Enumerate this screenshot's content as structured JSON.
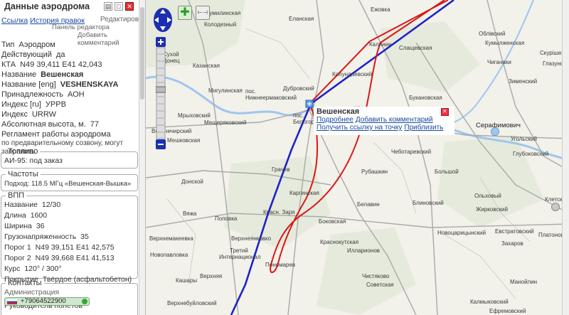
{
  "panel": {
    "title": "Данные аэродрома",
    "links": {
      "link": "Ссылка",
      "history": "История правок"
    },
    "edit": "Редактировать",
    "editor_panel": "Панель редактора",
    "add_comment": "Добавить комментарий",
    "rows": [
      {
        "label": "Тип",
        "value": "Аэродром"
      },
      {
        "label": "Действующий",
        "value": "да"
      },
      {
        "label": "КТА",
        "value": "N49 39,411 E41 42,043"
      },
      {
        "label": "Название",
        "value": "Вешенская"
      },
      {
        "label": "Название [eng]",
        "value": "VESHENSKAYA"
      },
      {
        "label": "Принадлежность",
        "value": "АОН"
      },
      {
        "label": "Индекс [ru]",
        "value": "УРРВ"
      },
      {
        "label": "Индекс",
        "value": "URRW"
      },
      {
        "label": "Абсолютная высота, м.",
        "value": "77"
      }
    ],
    "reglament_label": "Регламент работы аэродрома",
    "reglament_text": "по предварительному созвону, могут заправить",
    "fuel": {
      "legend": "Топливо",
      "text": "АИ-95: под заказ"
    },
    "freq": {
      "legend": "Частоты",
      "text": "Подход: 118.5 МГц «Вешенская-Вышка»"
    },
    "runway": {
      "legend": "ВПП",
      "rows": [
        {
          "label": "Название",
          "value": "12/30"
        },
        {
          "label": "Длина",
          "value": "1600"
        },
        {
          "label": "Ширина",
          "value": "36"
        },
        {
          "label": "Грузонапряженность",
          "value": "35"
        },
        {
          "label": "Порог 1",
          "value": "N49 39,151 E41 42,575"
        },
        {
          "label": "Порог 2",
          "value": "N49 39,668 E41 41,513"
        },
        {
          "label": "Курс",
          "value": "120° / 300°"
        },
        {
          "label": "Покрытие",
          "value": "Твёрдое (асфальтобетон)"
        }
      ]
    },
    "contacts": {
      "legend": "Контакты",
      "admin": "Администрация",
      "head": "Руководитель полётов",
      "phone": "+79064522900"
    }
  },
  "map": {
    "popup": {
      "title": "Вешенская",
      "link_more": "Подробнее",
      "link_comment": "Добавить комментарий",
      "link_point": "Получить ссылку на точку",
      "link_zoom": "Приблизить"
    },
    "places": [
      {
        "text": "Шумилинская"
      },
      {
        "text": "Еланская"
      },
      {
        "text": "Ежовка"
      },
      {
        "text": "Колодезный"
      },
      {
        "text": "Калинин"
      },
      {
        "text": "Слащевская"
      },
      {
        "text": "Облівский"
      },
      {
        "text": "Кумылженская"
      },
      {
        "text": "Скурішенская"
      },
      {
        "text": "Глазуновская"
      },
      {
        "text": "Чиганаки"
      },
      {
        "text": "Зименский"
      },
      {
        "text": "Сухой Донец"
      },
      {
        "text": "Казанская"
      },
      {
        "text": "Колундаевский"
      },
      {
        "text": "Букановская"
      },
      {
        "text": "пос. Нижнеермаковский"
      },
      {
        "text": "Дубровский"
      },
      {
        "text": "Мигулинская"
      },
      {
        "text": "Мрыховский"
      },
      {
        "text": "Мещеряковский"
      },
      {
        "text": "пос. Белогорск"
      },
      {
        "text": "Серафимович"
      },
      {
        "text": "Угольский"
      },
      {
        "text": "Верхнечирский"
      },
      {
        "text": "Мешковская"
      },
      {
        "text": "Чеботаревский"
      },
      {
        "text": "Глубоковский"
      },
      {
        "text": "Грачев"
      },
      {
        "text": "Рубашкин"
      },
      {
        "text": "Большой"
      },
      {
        "text": "Донской"
      },
      {
        "text": "Каргинская"
      },
      {
        "text": "Белавин"
      },
      {
        "text": "Блиновский"
      },
      {
        "text": "Ольховый"
      },
      {
        "text": "Жирковский"
      },
      {
        "text": "Клетский"
      },
      {
        "text": "Вяжа"
      },
      {
        "text": "Красн. Заря"
      },
      {
        "text": "Поповка"
      },
      {
        "text": "Боковская"
      },
      {
        "text": "Верхнемакеевка"
      },
      {
        "text": "Верхнеянковко"
      },
      {
        "text": "Краснокутская"
      },
      {
        "text": "Новоцарицынский"
      },
      {
        "text": "Евстратовский"
      },
      {
        "text": "Платонов"
      },
      {
        "text": "Новопавловка"
      },
      {
        "text": "Третий Интернационал"
      },
      {
        "text": "Илларионов"
      },
      {
        "text": "Захаров"
      },
      {
        "text": "Пономарев"
      },
      {
        "text": "Чистяково"
      },
      {
        "text": "Манойлин"
      },
      {
        "text": "Кашары"
      },
      {
        "text": "Верхняя"
      },
      {
        "text": "Советская"
      },
      {
        "text": "Калмыковский"
      },
      {
        "text": "Верхнебуйловский"
      },
      {
        "text": "Ефремовский"
      }
    ]
  },
  "colors": {
    "route_blue": "#1c22c8",
    "route_red": "#d81818",
    "road": "#a9a9a9",
    "water": "#9ec6f0"
  }
}
